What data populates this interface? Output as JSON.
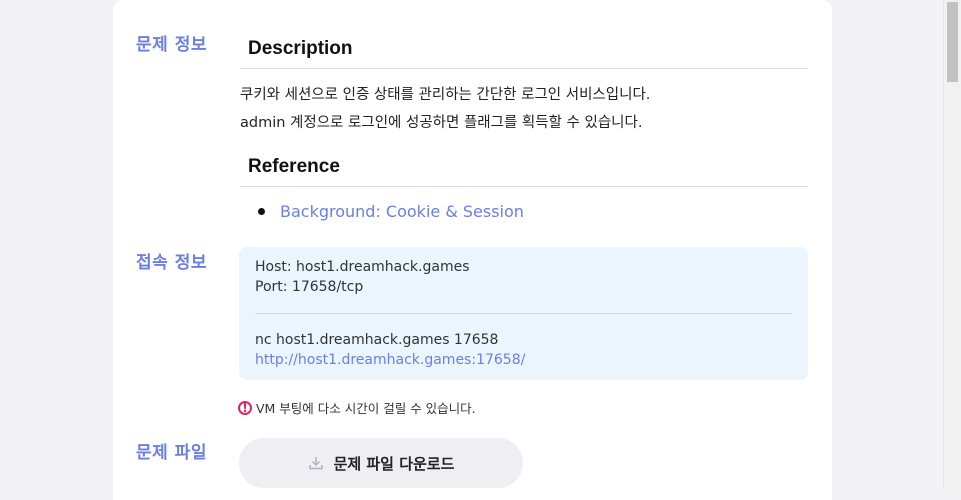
{
  "sections": {
    "info_label": "문제 정보",
    "conn_label": "접속 정보",
    "file_label": "문제 파일"
  },
  "description": {
    "heading": "Description",
    "line1": "쿠키와 세션으로 인증 상태를 관리하는 간단한 로그인 서비스입니다.",
    "line2": "admin 계정으로 로그인에 성공하면 플래그를 획득할 수 있습니다."
  },
  "reference": {
    "heading": "Reference",
    "items": [
      {
        "label": "Background: Cookie & Session"
      }
    ]
  },
  "connection": {
    "host": "Host: host1.dreamhack.games",
    "port": "Port: 17658/tcp",
    "nc": "nc host1.dreamhack.games 17658",
    "url": "http://host1.dreamhack.games:17658/"
  },
  "warning": {
    "icon": "exclamation-circle-icon",
    "text": "VM 부팅에 다소 시간이 걸릴 수 있습니다."
  },
  "download": {
    "label": "문제 파일 다운로드",
    "icon": "download-icon"
  },
  "colors": {
    "accent": "#6b7fe0",
    "info_box": "#eaf5fd",
    "warning": "#e0245e"
  }
}
